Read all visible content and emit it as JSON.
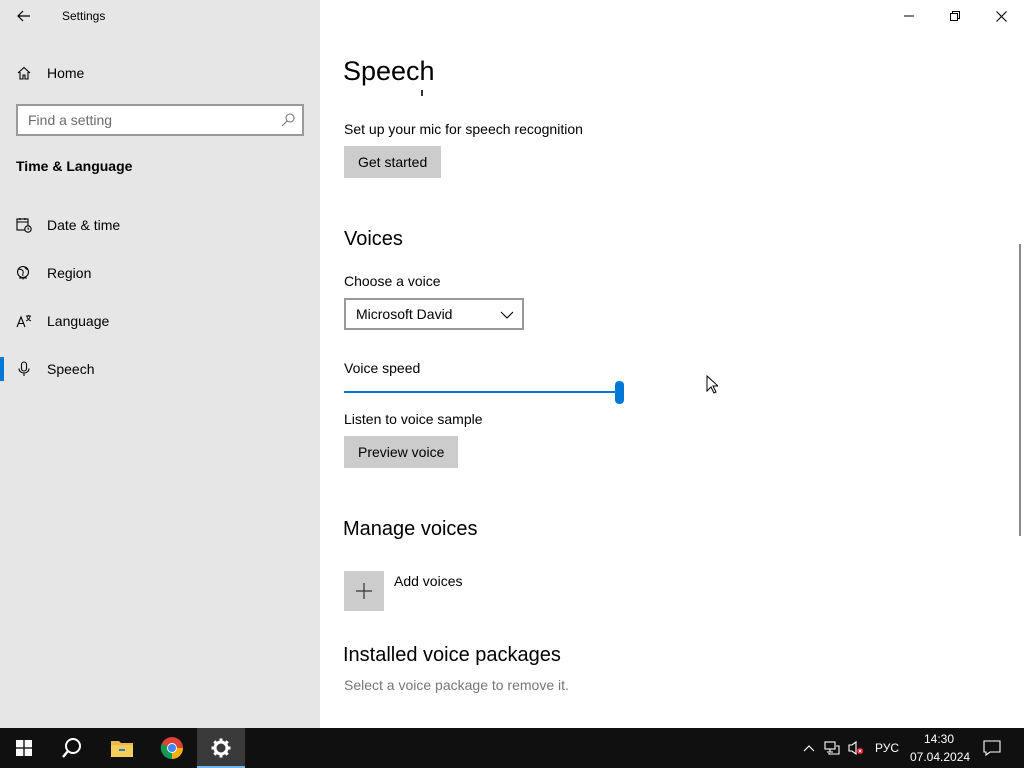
{
  "window": {
    "title": "Settings",
    "controls": {
      "minimize": "minimize-icon",
      "restore": "restore-icon",
      "close": "close-icon"
    }
  },
  "sidebar": {
    "home_label": "Home",
    "search": {
      "placeholder": "Find a setting",
      "value": ""
    },
    "section_title": "Time & Language",
    "items": [
      {
        "label": "Date & time",
        "icon": "calendar-clock-icon",
        "selected": false
      },
      {
        "label": "Region",
        "icon": "globe-icon",
        "selected": false
      },
      {
        "label": "Language",
        "icon": "language-icon",
        "selected": false
      },
      {
        "label": "Speech",
        "icon": "microphone-icon",
        "selected": true
      }
    ]
  },
  "main": {
    "page_title": "Speech",
    "mic": {
      "description": "Set up your mic for speech recognition",
      "button_label": "Get started"
    },
    "voices": {
      "heading": "Voices",
      "choose_label": "Choose a voice",
      "selected_voice": "Microsoft David",
      "speed_label": "Voice speed",
      "speed_level": 1.0,
      "listen_label": "Listen to voice sample",
      "preview_button": "Preview voice"
    },
    "manage": {
      "heading": "Manage voices",
      "add_label": "Add voices"
    },
    "installed": {
      "heading": "Installed voice packages",
      "description": "Select a voice package to remove it."
    }
  },
  "taskbar": {
    "apps": [
      "windows-start-icon",
      "search-icon",
      "file-explorer-icon",
      "chrome-icon",
      "settings-gear-icon"
    ],
    "language": "РУС",
    "time": "14:30",
    "date": "07.04.2024"
  },
  "colors": {
    "accent": "#0078d7",
    "sidebar_bg": "#e6e6e6",
    "button_bg": "#cccccc",
    "taskbar_bg": "#101010"
  }
}
